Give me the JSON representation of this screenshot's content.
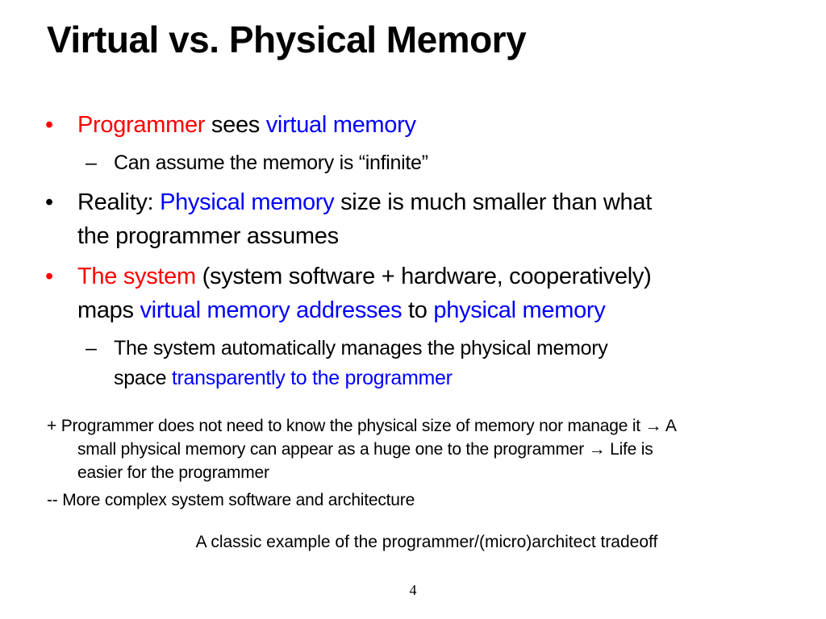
{
  "slide": {
    "title": "Virtual vs. Physical Memory",
    "bullets": [
      {
        "marker": "•",
        "marker_color": "#ff0000",
        "segments": [
          {
            "text": "Programmer",
            "color": "#ff0000"
          },
          {
            "text": " sees ",
            "color": "#000000"
          },
          {
            "text": "virtual memory",
            "color": "#0000ff"
          }
        ],
        "sub": [
          {
            "marker": "–",
            "segments": [
              {
                "text": "Can assume the memory is “infinite”",
                "color": "#000000"
              }
            ]
          }
        ]
      },
      {
        "marker": "•",
        "marker_color": "#000000",
        "line1": [
          {
            "text": "Reality: ",
            "color": "#000000"
          },
          {
            "text": "Physical memory",
            "color": "#0000ff"
          },
          {
            "text": " size is much smaller than what",
            "color": "#000000"
          }
        ],
        "line2": [
          {
            "text": "the programmer assumes",
            "color": "#000000"
          }
        ]
      },
      {
        "marker": "•",
        "marker_color": "#ff0000",
        "line1": [
          {
            "text": "The system",
            "color": "#ff0000"
          },
          {
            "text": " (system software + hardware, cooperatively)",
            "color": "#000000"
          }
        ],
        "line2": [
          {
            "text": "maps ",
            "color": "#000000"
          },
          {
            "text": "virtual memory addresses",
            "color": "#0000ff"
          },
          {
            "text": " to ",
            "color": "#000000"
          },
          {
            "text": "physical memory",
            "color": "#0000ff"
          }
        ],
        "sub": [
          {
            "marker": "–",
            "line1": [
              {
                "text": "The system automatically manages the physical memory",
                "color": "#000000"
              }
            ],
            "line2": [
              {
                "text": "space ",
                "color": "#000000"
              },
              {
                "text": "transparently to the programmer",
                "color": "#0000ff"
              }
            ]
          }
        ]
      }
    ],
    "pro_note": {
      "line1": "+ Programmer does not need to know the physical size of memory nor manage it → A",
      "line2": "small physical memory can appear as a huge one to the programmer → Life is",
      "line3": "easier for the programmer"
    },
    "con_note": "-- More complex system software and architecture",
    "tradeoff_caption": "A classic example of the programmer/(micro)architect tradeoff",
    "page_number": "4"
  }
}
